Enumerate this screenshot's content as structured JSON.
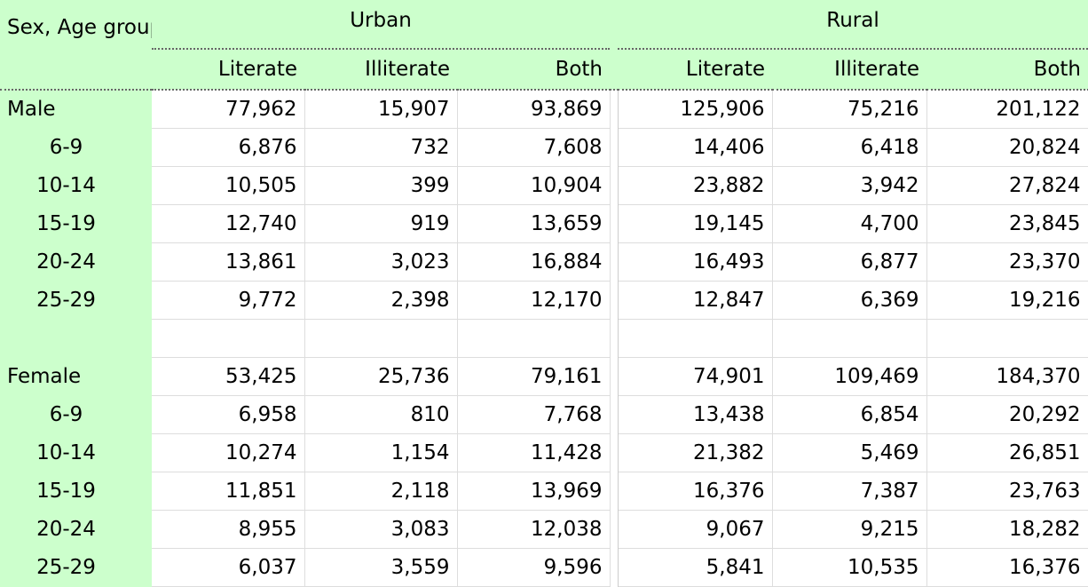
{
  "header": {
    "corner_label": "Sex, Age group",
    "groups": [
      "Urban",
      "Rural"
    ],
    "columns": [
      "Literate",
      "Illiterate",
      "Both",
      "Literate",
      "Illiterate",
      "Both"
    ]
  },
  "rows": [
    {
      "label": "Male",
      "values": [
        "77,962",
        "15,907",
        "93,869",
        "125,906",
        "75,216",
        "201,122"
      ]
    },
    {
      "label": "6-9",
      "values": [
        "6,876",
        "732",
        "7,608",
        "14,406",
        "6,418",
        "20,824"
      ]
    },
    {
      "label": "10-14",
      "values": [
        "10,505",
        "399",
        "10,904",
        "23,882",
        "3,942",
        "27,824"
      ]
    },
    {
      "label": "15-19",
      "values": [
        "12,740",
        "919",
        "13,659",
        "19,145",
        "4,700",
        "23,845"
      ]
    },
    {
      "label": "20-24",
      "values": [
        "13,861",
        "3,023",
        "16,884",
        "16,493",
        "6,877",
        "23,370"
      ]
    },
    {
      "label": "25-29",
      "values": [
        "9,772",
        "2,398",
        "12,170",
        "12,847",
        "6,369",
        "19,216"
      ]
    },
    {
      "label": "",
      "values": [
        "",
        "",
        "",
        "",
        "",
        ""
      ]
    },
    {
      "label": "Female",
      "values": [
        "53,425",
        "25,736",
        "79,161",
        "74,901",
        "109,469",
        "184,370"
      ]
    },
    {
      "label": "6-9",
      "values": [
        "6,958",
        "810",
        "7,768",
        "13,438",
        "6,854",
        "20,292"
      ]
    },
    {
      "label": "10-14",
      "values": [
        "10,274",
        "1,154",
        "11,428",
        "21,382",
        "5,469",
        "26,851"
      ]
    },
    {
      "label": "15-19",
      "values": [
        "11,851",
        "2,118",
        "13,969",
        "16,376",
        "7,387",
        "23,763"
      ]
    },
    {
      "label": "20-24",
      "values": [
        "8,955",
        "3,083",
        "12,038",
        "9,067",
        "9,215",
        "18,282"
      ]
    },
    {
      "label": "25-29",
      "values": [
        "6,037",
        "3,559",
        "9,596",
        "5,841",
        "10,535",
        "16,376"
      ]
    }
  ],
  "styles": {
    "header_bg": "#ccffcc",
    "stub_bg": "#ccffcc"
  }
}
